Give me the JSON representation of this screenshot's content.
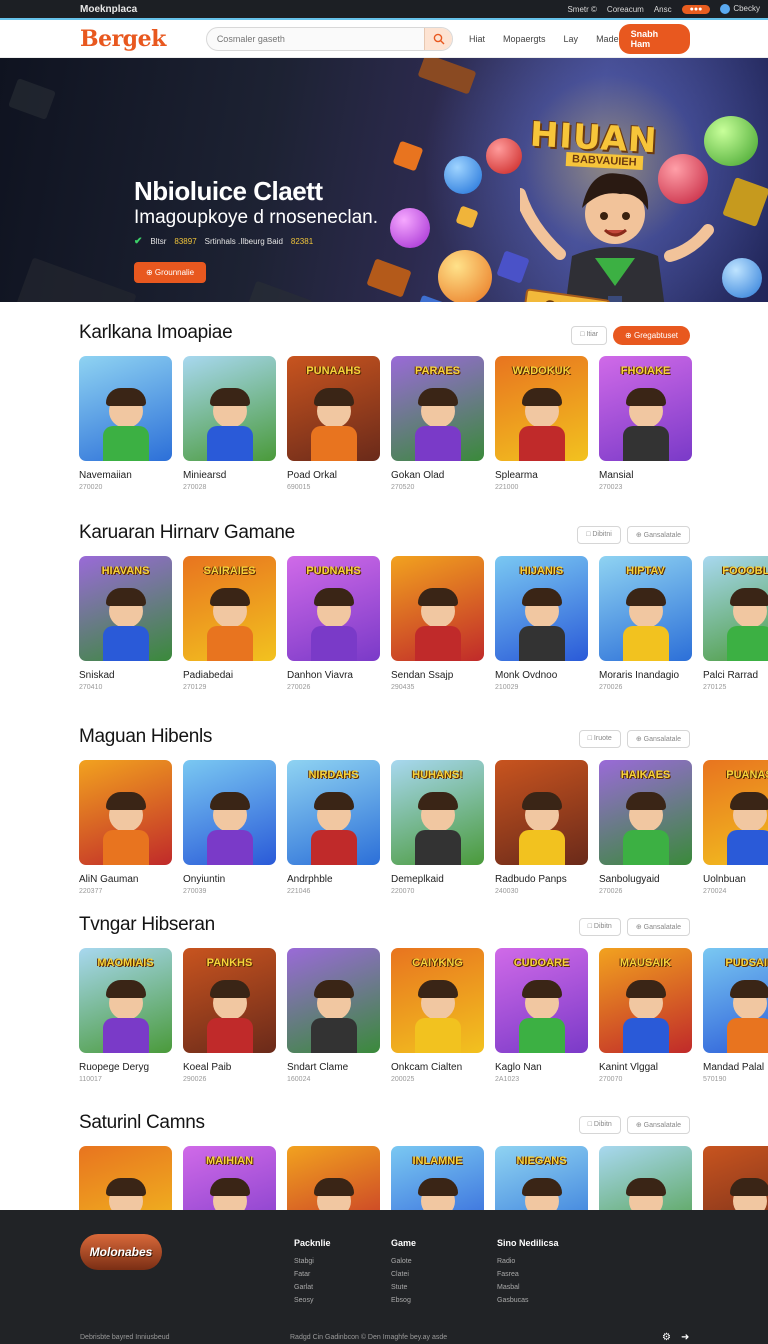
{
  "topbar": {
    "brand": "Moeknplaca",
    "links": [
      "Smetr ©",
      "Coreacum",
      "Ansc"
    ],
    "pill": "●●●",
    "account": "Cbecky"
  },
  "header": {
    "logo": "Bergek",
    "search_placeholder": "Cosmaler gaseth",
    "nav": [
      "Hiat",
      "Mopaergts",
      "Lay",
      "Made"
    ],
    "cta": "Snabh Ham"
  },
  "hero": {
    "title": "Nbioluice Claett",
    "subtitle": "Imagoupkoye d rnoseneclan.",
    "meta_1": "Bltsr",
    "meta_1_value": "83897",
    "meta_2": "Srtinhals .Ilbeurg Baid",
    "meta_2_value": "82381",
    "button": "⊕ Grounnalie",
    "art_title": "HIUAN",
    "art_subtitle": "BABVAUIEH",
    "art_sign": "GAME"
  },
  "sections": [
    {
      "title": "Karlkana Imoapiae",
      "actions": [
        "□ Itiar",
        "⊕ Gregabtuset"
      ],
      "cards": [
        {
          "name": "Navemaiian",
          "num": "270020",
          "art": ""
        },
        {
          "name": "Miniearsd",
          "num": "270028",
          "art": ""
        },
        {
          "name": "Poad Orkal",
          "num": "690015",
          "art": "PUNAAHS"
        },
        {
          "name": "Gokan Olad",
          "num": "270520",
          "art": "PARAES"
        },
        {
          "name": "Splearma",
          "num": "221000",
          "art": "WADOKUK"
        },
        {
          "name": "Mansial",
          "num": "270023",
          "art": "FHOIAKE"
        }
      ]
    },
    {
      "title": "Karuaran Hirnarv Gamane",
      "actions": [
        "□ Dibitni",
        "⊕ Gansalatale"
      ],
      "cards": [
        {
          "name": "Sniskad",
          "num": "270410",
          "art": "HIAVANS"
        },
        {
          "name": "Padiabedai",
          "num": "270129",
          "art": "SAIRAIES"
        },
        {
          "name": "Danhon Viavra",
          "num": "270026",
          "art": "PUDNAHS"
        },
        {
          "name": "Sendan Ssajp",
          "num": "290435",
          "art": ""
        },
        {
          "name": "Monk Ovdnoo",
          "num": "210029",
          "art": "HIJANIS"
        },
        {
          "name": "Moraris Inandagio",
          "num": "270026",
          "art": "HIPTAV"
        },
        {
          "name": "Palci Rarrad",
          "num": "270125",
          "art": "FOOOBLE"
        }
      ]
    },
    {
      "title": "Maguan Hibenls",
      "actions": [
        "□ Iruote",
        "⊕ Gansalatale"
      ],
      "cards": [
        {
          "name": "AliN Gauman",
          "num": "220377",
          "art": ""
        },
        {
          "name": "Onyiuntin",
          "num": "270039",
          "art": ""
        },
        {
          "name": "Andrphble",
          "num": "221046",
          "art": "NIRDAHS"
        },
        {
          "name": "Demeplkaid",
          "num": "220070",
          "art": "HUHANS!"
        },
        {
          "name": "Radbudo Panps",
          "num": "240030",
          "art": ""
        },
        {
          "name": "Sanbolugyaid",
          "num": "270026",
          "art": "HAIKAES"
        },
        {
          "name": "Uolnbuan",
          "num": "270024",
          "art": "PUANAS"
        }
      ]
    },
    {
      "title": "Tvngar Hibseran",
      "actions": [
        "□ Dibitn",
        "⊕ Gansalatale"
      ],
      "cards": [
        {
          "name": "Ruopege Deryg",
          "num": "110017",
          "art": "MAOMIAIS"
        },
        {
          "name": "Koeal Paib",
          "num": "290026",
          "art": "PANKHS"
        },
        {
          "name": "Sndart Clame",
          "num": "160024",
          "art": ""
        },
        {
          "name": "Onkcam Cialten",
          "num": "200025",
          "art": "CAIYKNG"
        },
        {
          "name": "Kaglo Nan",
          "num": "2A1023",
          "art": "CUDOARE"
        },
        {
          "name": "Kanint Vlggal",
          "num": "270070",
          "art": "MAUSAIK"
        },
        {
          "name": "Mandad Palal",
          "num": "570190",
          "art": "PUDSAIL"
        }
      ]
    },
    {
      "title": "Saturinl Camns",
      "actions": [
        "□ Dibitn",
        "⊕ Gansalatale"
      ],
      "cards": [
        {
          "name": "",
          "num": "",
          "art": ""
        },
        {
          "name": "",
          "num": "",
          "art": "MAIHIAN"
        },
        {
          "name": "",
          "num": "",
          "art": ""
        },
        {
          "name": "",
          "num": "",
          "art": "INLAMNE"
        },
        {
          "name": "",
          "num": "",
          "art": "NIEGANS"
        },
        {
          "name": "",
          "num": "",
          "art": ""
        },
        {
          "name": "",
          "num": "",
          "art": ""
        }
      ]
    }
  ],
  "footer": {
    "logo": "Molonabes",
    "cols": [
      {
        "title": "Packnlie",
        "items": [
          "Stabgi",
          "Fatar",
          "Garlat",
          "Seosy"
        ]
      },
      {
        "title": "Game",
        "items": [
          "Galote",
          "Clatei",
          "Stute",
          "Ebsog"
        ]
      },
      {
        "title": "Sino Nedilicsa",
        "items": [
          "Radio",
          "Fasrea",
          "Masbal",
          "Gasbucas"
        ]
      }
    ],
    "bottom_left": "Debrisbte bayred Inniusbeud",
    "bottom_mid": "Radgd Cin Gadinbcon © Den Imaghfe bey.ay asde"
  }
}
